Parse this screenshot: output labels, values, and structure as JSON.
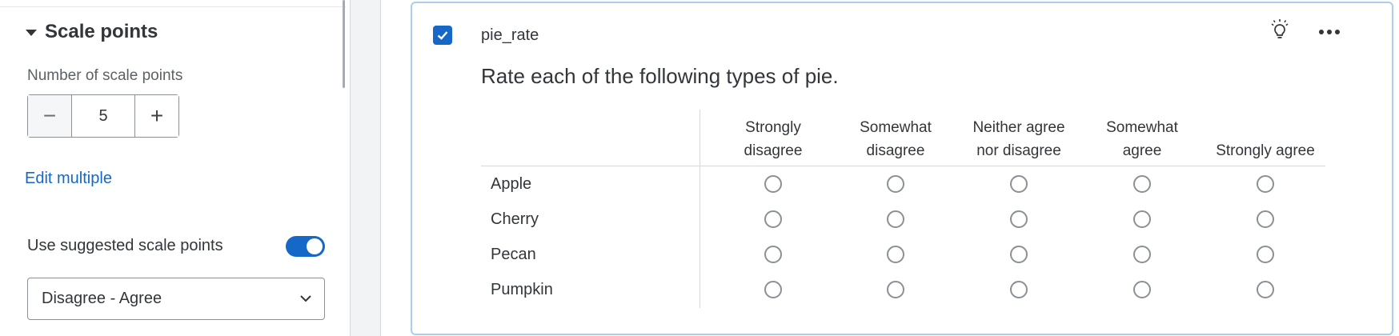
{
  "left_panel": {
    "section_title": "Scale points",
    "scale_points_label": "Number of scale points",
    "stepper_value": "5",
    "stepper_minus": "−",
    "stepper_plus": "+",
    "edit_link": "Edit multiple",
    "suggested_label": "Use suggested scale points",
    "suggested_enabled": true,
    "scale_select_value": "Disagree - Agree"
  },
  "question": {
    "id": "pie_rate",
    "selected": true,
    "text": "Rate each of the following types of pie.",
    "columns": [
      {
        "line1": "Strongly",
        "line2": "disagree"
      },
      {
        "line1": "Somewhat",
        "line2": "disagree"
      },
      {
        "line1": "Neither agree",
        "line2": "nor disagree"
      },
      {
        "line1": "Somewhat",
        "line2": "agree"
      },
      {
        "line1": "",
        "line2": "Strongly agree"
      }
    ],
    "rows": [
      "Apple",
      "Cherry",
      "Pecan",
      "Pumpkin"
    ]
  },
  "icons": {
    "caret": "caret-down-icon",
    "checkbox": "checkmark-icon",
    "bulb": "lightbulb-icon",
    "more": "more-horizontal-icon",
    "select": "chevron-down-icon"
  },
  "colors": {
    "accent": "#1568c8",
    "card_border": "#a9cef2",
    "radio_border": "#8b9096"
  }
}
